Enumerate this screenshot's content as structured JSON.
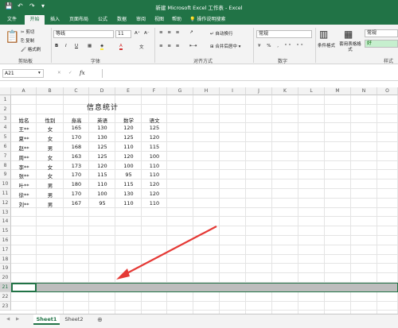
{
  "title_bar": {
    "title": "新建 Microsoft Excel 工作表 - Excel"
  },
  "ribbon_tabs": [
    "文件",
    "开始",
    "插入",
    "页面布局",
    "公式",
    "数据",
    "审阅",
    "视图",
    "帮助"
  ],
  "tell_me": "操作说明搜索",
  "clipboard": {
    "cut": "剪切",
    "copy": "复制",
    "format_painter": "格式刷",
    "label": "剪贴板"
  },
  "font": {
    "name": "等线",
    "size": "11",
    "label": "字体"
  },
  "alignment": {
    "wrap": "自动换行",
    "merge": "合并后居中",
    "label": "对齐方式"
  },
  "number": {
    "format": "常规",
    "label": "数字"
  },
  "styles": {
    "conditional": "条件格式",
    "table_format": "套用表格格式",
    "style_normal": "常规",
    "style_good": "好",
    "label": "样式"
  },
  "name_box": "A21",
  "fx": "fx",
  "columns": [
    "A",
    "B",
    "C",
    "D",
    "E",
    "F",
    "G",
    "H",
    "I",
    "J",
    "K",
    "L",
    "M",
    "N",
    "O"
  ],
  "rows": [
    "1",
    "2",
    "3",
    "4",
    "5",
    "6",
    "7",
    "8",
    "9",
    "10",
    "11",
    "12",
    "13",
    "14",
    "15",
    "16",
    "17",
    "18",
    "19",
    "20",
    "21",
    "22",
    "23"
  ],
  "table": {
    "title": "信息统计",
    "headers": [
      "姓名",
      "性别",
      "身高",
      "英语",
      "数学",
      "语文"
    ],
    "rows": [
      [
        "王**",
        "女",
        "165",
        "130",
        "120",
        "125"
      ],
      [
        "夏**",
        "女",
        "170",
        "130",
        "125",
        "120"
      ],
      [
        "赵**",
        "男",
        "168",
        "125",
        "110",
        "115"
      ],
      [
        "周**",
        "女",
        "163",
        "125",
        "120",
        "100"
      ],
      [
        "李**",
        "女",
        "173",
        "120",
        "100",
        "110"
      ],
      [
        "张**",
        "女",
        "170",
        "115",
        "95",
        "110"
      ],
      [
        "叶**",
        "男",
        "180",
        "110",
        "115",
        "120"
      ],
      [
        "徐**",
        "男",
        "170",
        "100",
        "130",
        "120"
      ],
      [
        "刘**",
        "男",
        "167",
        "95",
        "110",
        "110"
      ]
    ]
  },
  "sheets": [
    "Sheet1",
    "Sheet2"
  ],
  "colors": {
    "excel_green": "#217346",
    "selected_row": "#bdbdbd",
    "arrow": "#e53935"
  }
}
